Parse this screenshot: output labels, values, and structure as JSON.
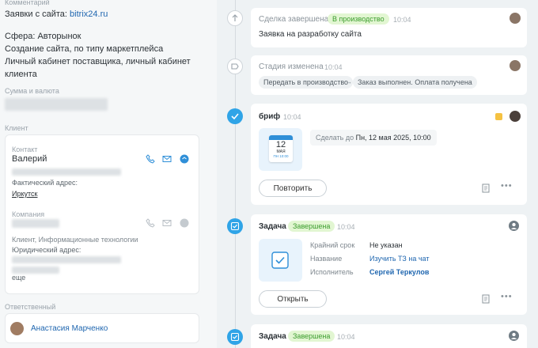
{
  "left": {
    "comment_label": "Комментарий",
    "comment_line1_prefix": "Заявки с сайта: ",
    "comment_line1_link": "bitrix24.ru",
    "comment_line2": "Сфера: Авторынок",
    "comment_line3": "Создание сайта, по типу маркетплейса",
    "comment_line4": "Личный кабинет поставщика, личный кабинет",
    "comment_line5": "клиента",
    "amount_label": "Сумма и валюта",
    "client_label": "Клиент",
    "contact": {
      "type_label": "Контакт",
      "name": "Валерий",
      "address_label": "Фактический адрес:",
      "address_value": "Иркутск"
    },
    "company": {
      "type_label": "Компания",
      "category": "Клиент, Информационные технологии",
      "address_label": "Юридический адрес:",
      "more": "еще"
    },
    "responsible_label": "Ответственный",
    "responsible_name": "Анастасия Марченко"
  },
  "timeline": {
    "deal": {
      "title": "Сделка завершена",
      "badge": "В производство",
      "time": "10:04",
      "text": "Заявка на разработку сайта"
    },
    "stage": {
      "title": "Стадия изменена",
      "time": "10:04",
      "from": "Передать в производство",
      "arrow": "→",
      "to": "Заказ выполнен. Оплата получена"
    },
    "brief": {
      "title": "бриф",
      "time": "10:04",
      "cal_day": "12",
      "cal_month": "МАЯ",
      "cal_time": "ПН 10:00",
      "deadline_prefix": "Сделать до ",
      "deadline_value": "Пн, 12 мая 2025, 10:00",
      "button": "Повторить",
      "accent_color": "#f5c242"
    },
    "task1": {
      "label": "Задача",
      "badge": "Завершена",
      "time": "10:04",
      "deadline_key": "Крайний срок",
      "deadline_val": "Не указан",
      "name_key": "Название",
      "name_val": "Изучить ТЗ на чат",
      "exec_key": "Исполнитель",
      "exec_val": "Сергей Теркулов",
      "button": "Открыть"
    },
    "task2": {
      "label": "Задача",
      "badge": "Завершена",
      "time": "10:04"
    },
    "more_glyph": "•••"
  }
}
